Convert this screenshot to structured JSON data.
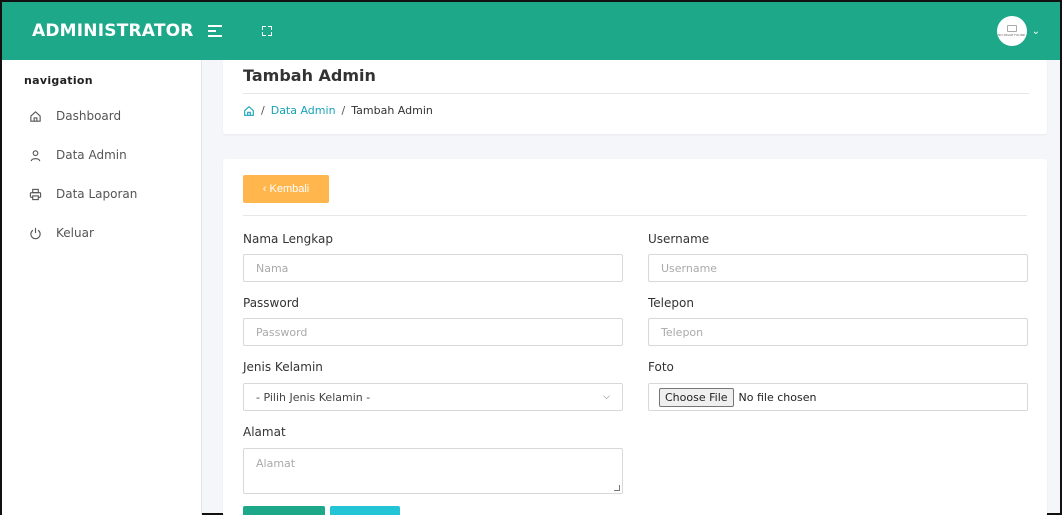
{
  "header": {
    "brand": "ADMINISTRATOR",
    "menu_icon": "menu-icon",
    "fullscreen_icon": "expand-icon",
    "avatar_text": "NO IMAGE FOUND",
    "accent_color": "#1ea88a"
  },
  "sidebar": {
    "title": "navigation",
    "items": [
      {
        "label": "Dashboard",
        "icon": "home-icon"
      },
      {
        "label": "Data Admin",
        "icon": "user-icon"
      },
      {
        "label": "Data Laporan",
        "icon": "printer-icon"
      },
      {
        "label": "Keluar",
        "icon": "power-icon"
      }
    ]
  },
  "page": {
    "title": "Tambah Admin",
    "breadcrumb": [
      "Data Admin",
      "Tambah Admin"
    ]
  },
  "form": {
    "back_label": "‹  Kembali",
    "fields": {
      "nama": {
        "label": "Nama Lengkap",
        "placeholder": "Nama"
      },
      "username": {
        "label": "Username",
        "placeholder": "Username"
      },
      "password": {
        "label": "Password",
        "placeholder": "Password"
      },
      "telepon": {
        "label": "Telepon",
        "placeholder": "Telepon"
      },
      "jenis_kelamin": {
        "label": "Jenis Kelamin",
        "value": "- Pilih Jenis Kelamin -"
      },
      "foto": {
        "label": "Foto",
        "button": "Choose File",
        "status": "No file chosen"
      },
      "alamat": {
        "label": "Alamat",
        "placeholder": "Alamat"
      }
    },
    "save_label": "",
    "reset_label": ""
  }
}
